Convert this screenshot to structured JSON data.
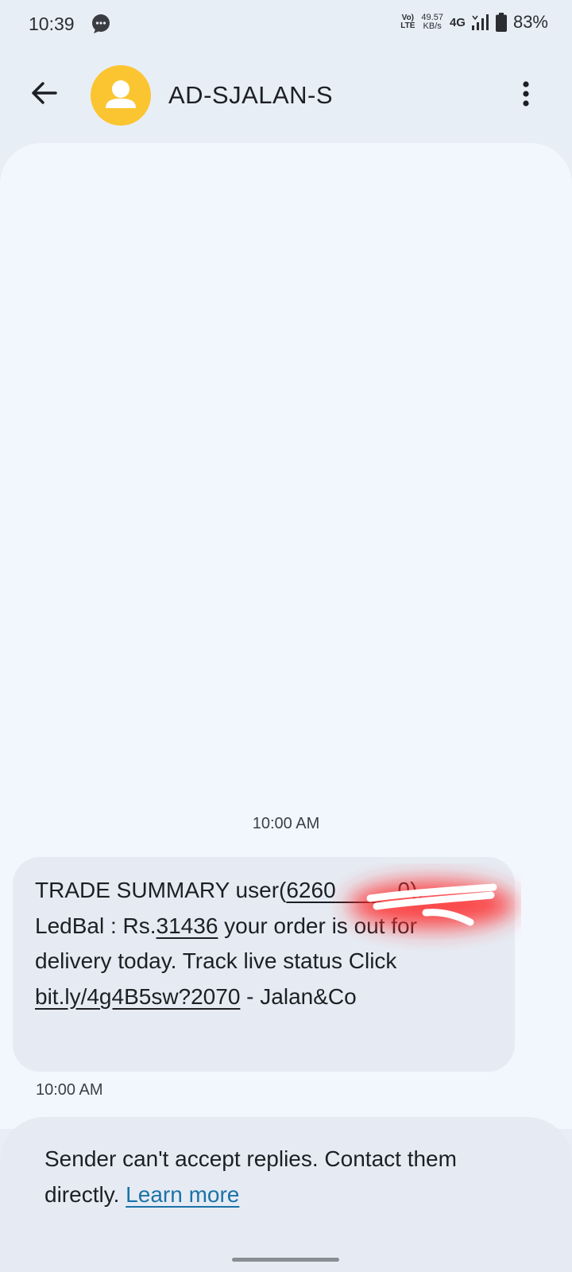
{
  "status_bar": {
    "time": "10:39",
    "volte_top": "Vo)",
    "volte_bottom": "LTE",
    "speed_value": "49.57",
    "speed_unit": "KB/s",
    "network": "4G",
    "battery_percent": "83%"
  },
  "header": {
    "contact_name": "AD-SJALAN-S",
    "avatar_color": "#fbc531"
  },
  "conversation": {
    "date_stamp": "10:00 AM",
    "message": {
      "part1": "TRADE SUMMARY user(",
      "phone_visible": "6260",
      "phone_hidden_tail": "0",
      "part2": ").",
      "part3": "LedBal : Rs.",
      "balance": "31436",
      "part4": "  your order is out for delivery today. Track live status Click ",
      "link": "bit.ly/4g4B5sw?2070",
      "part5": " - Jalan&Co"
    },
    "message_time": "10:00 AM"
  },
  "footer": {
    "notice": "Sender can't accept replies. Contact them directly. ",
    "learn_more": "Learn more"
  }
}
